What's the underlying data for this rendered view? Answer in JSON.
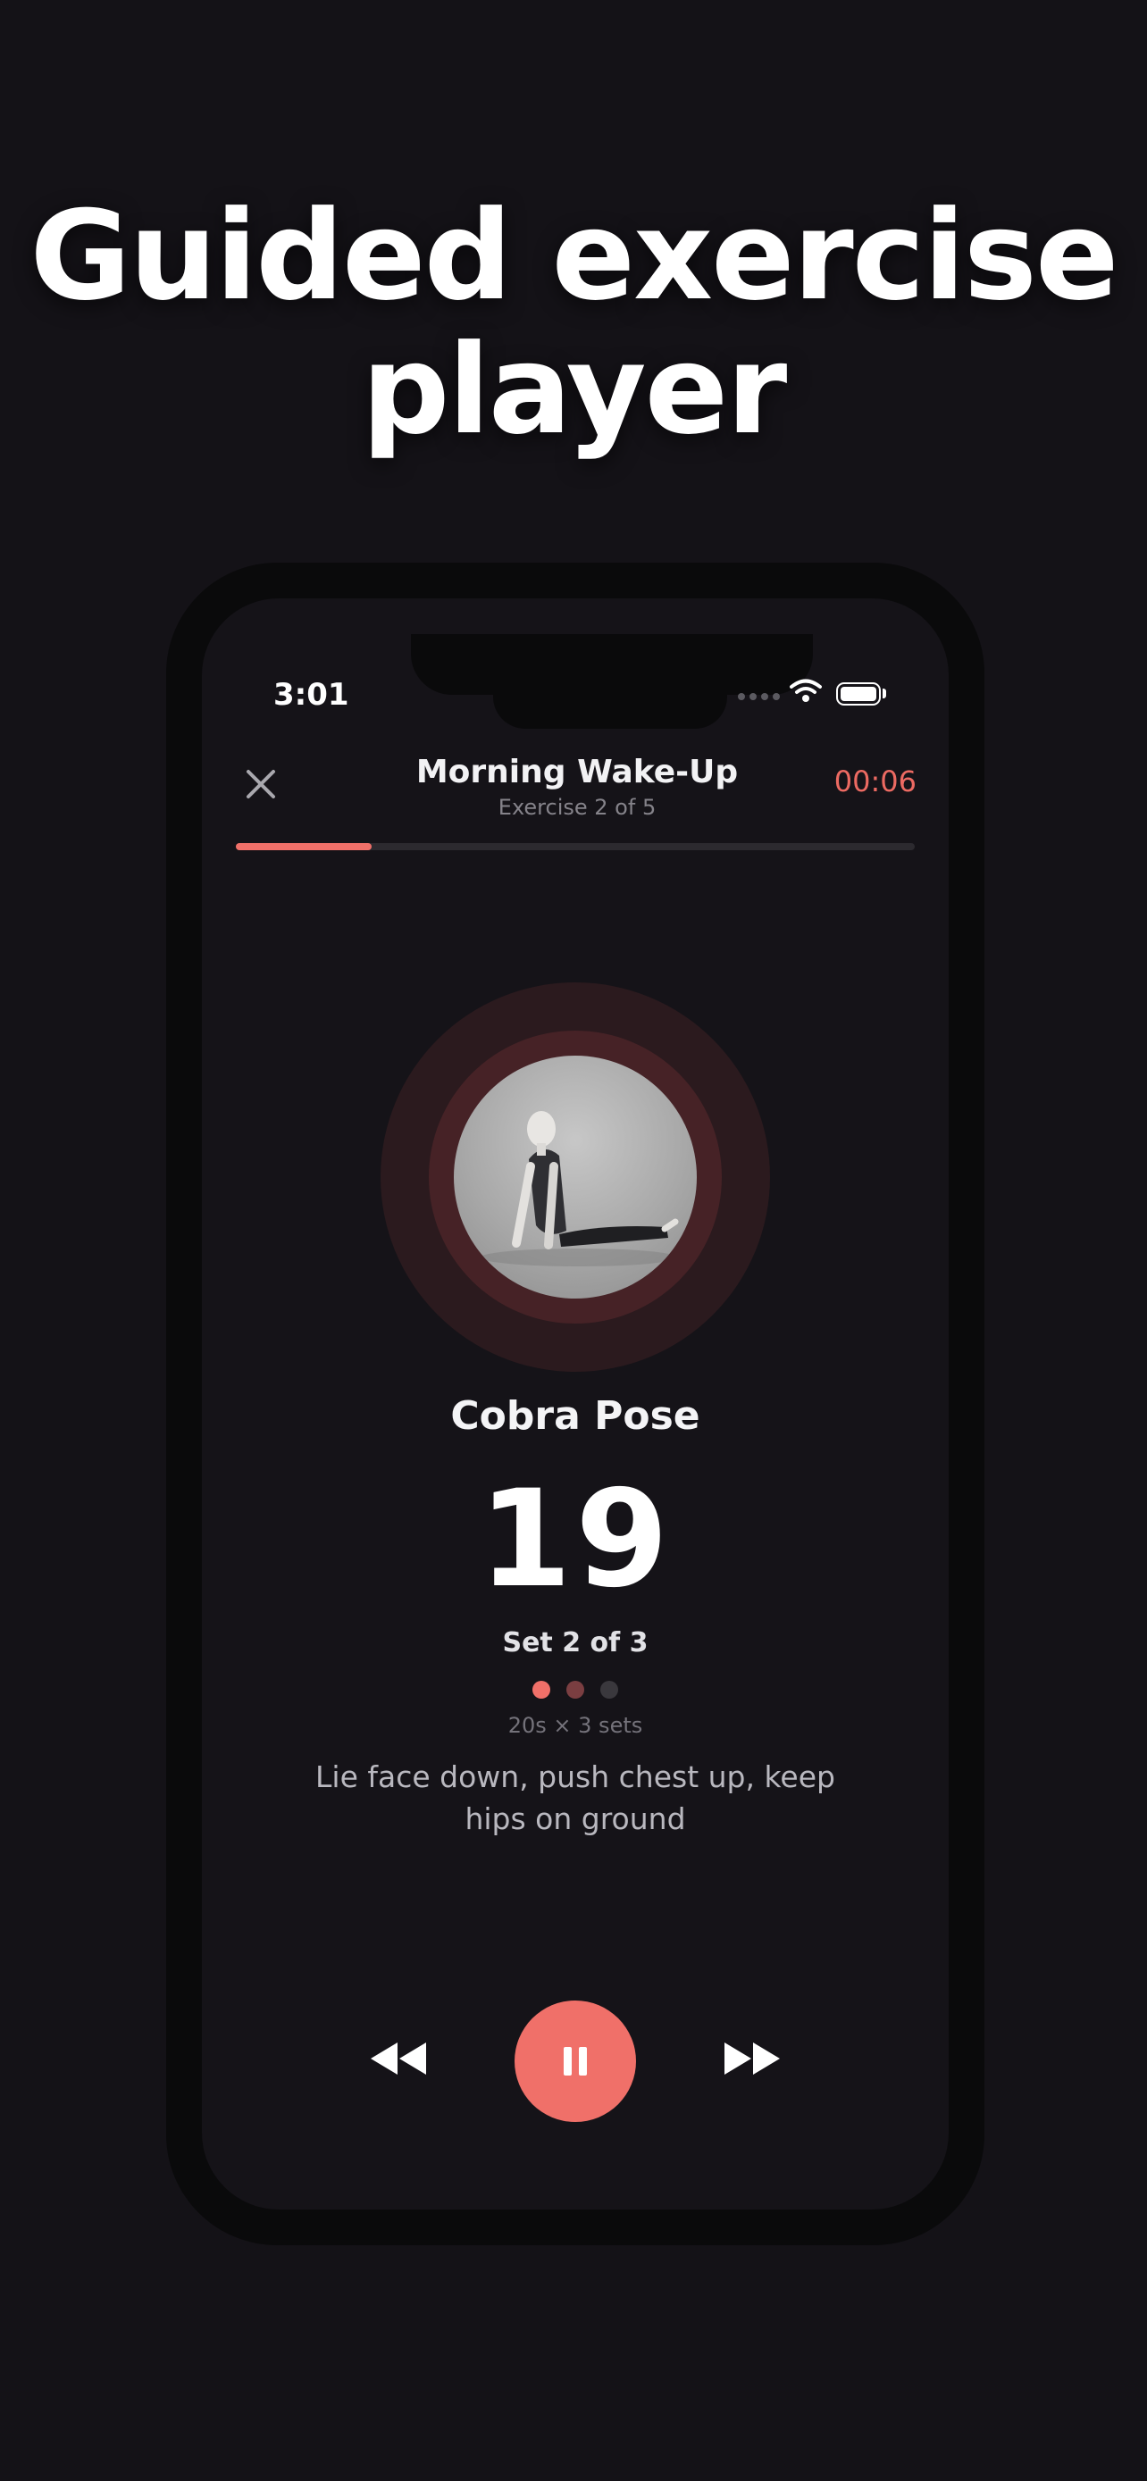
{
  "headline": {
    "line1": "Guided exercise",
    "line2": "player"
  },
  "status_bar": {
    "time": "3:01"
  },
  "header": {
    "title": "Morning Wake-Up",
    "subtitle": "Exercise 2 of 5",
    "timer": "00:06",
    "close_icon": "close-icon"
  },
  "progress": {
    "fraction": 0.2
  },
  "exercise": {
    "name": "Cobra Pose",
    "count": "19",
    "set_label": "Set 2 of 3",
    "sets_total": 3,
    "sets_done": 2,
    "scheme": "20s × 3 sets",
    "instruction": "Lie face down, push chest up, keep hips on ground"
  },
  "controls": {
    "previous_icon": "rewind-icon",
    "pause_icon": "pause-icon",
    "next_icon": "fast-forward-icon"
  },
  "colors": {
    "background": "#141217",
    "screen": "#151318",
    "accent": "#f07069",
    "timer": "#ec6a62",
    "dot_active": "#f07069",
    "dot_done": "#7a3e41",
    "dot_pending": "#3a383d"
  }
}
